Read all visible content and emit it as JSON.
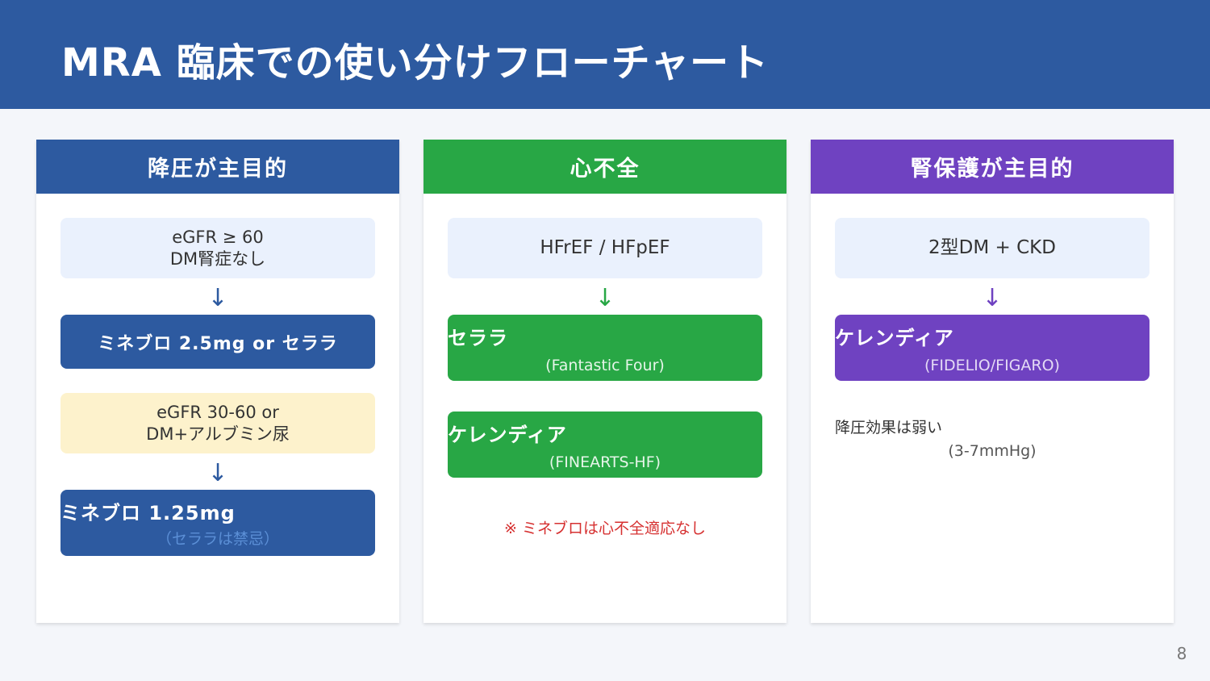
{
  "slide": {
    "title": "MRA 臨床での使い分けフローチャート",
    "page_number": "8"
  },
  "colors": {
    "header_bg": "#2d5aa0",
    "blue": "#2d5aa0",
    "green": "#28a745",
    "purple": "#6f42c1",
    "warning_red": "#d63131"
  },
  "columns": {
    "hypertension": {
      "heading": "降圧が主目的",
      "condition1": {
        "line1": "eGFR ≥ 60",
        "line2": "DM腎症なし"
      },
      "arrow1": "↓",
      "drug1": {
        "main": "ミネブロ 2.5mg or セララ"
      },
      "condition2": {
        "line1": "eGFR 30-60 or",
        "line2": "DM+アルブミン尿"
      },
      "arrow2": "↓",
      "drug2": {
        "main": "ミネブロ 1.25mg",
        "sub": "（セララは禁忌）"
      }
    },
    "heart_failure": {
      "heading": "心不全",
      "condition1": {
        "line1": "HFrEF / HFpEF"
      },
      "arrow1": "↓",
      "drug1": {
        "main": "セララ",
        "sub": "(Fantastic Four)"
      },
      "drug2": {
        "main": "ケレンディア",
        "sub": "(FINEARTS-HF)"
      },
      "note": "※ ミネブロは心不全適応なし"
    },
    "kidney": {
      "heading": "腎保護が主目的",
      "condition1": {
        "line1": "2型DM + CKD"
      },
      "arrow1": "↓",
      "drug1": {
        "main": "ケレンディア",
        "sub": "(FIDELIO/FIGARO)"
      },
      "note": {
        "line1": "降圧効果は弱い",
        "line2": "(3-7mmHg)"
      }
    }
  }
}
